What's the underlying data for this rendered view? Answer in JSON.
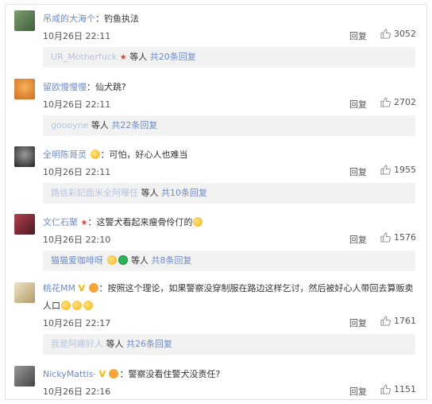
{
  "comments": [
    {
      "username": "吊咸的大海个",
      "text": "钓鱼执法",
      "date": "10月26日 22:11",
      "reply_label": "回复",
      "likes": "3052",
      "sub": {
        "names": "UR_Motherfuck",
        "suffix": "等人",
        "more": "共20条回复"
      },
      "avatar_color": "#5a7a56"
    },
    {
      "username": "留欧慢慢慢",
      "text": "仙犬跳?",
      "date": "10月26日 22:11",
      "reply_label": "回复",
      "likes": "2702",
      "sub": {
        "names": "goooyne",
        "suffix": "等人",
        "more": "共22条回复"
      },
      "avatar_color": "#e07c2a"
    },
    {
      "username": "全明陈哥灵",
      "text": "可怕，好心人也难当",
      "date": "10月26日 22:11",
      "reply_label": "回复",
      "likes": "1955",
      "sub": {
        "names": "路信彩妃面米全阿曝任",
        "suffix": "等人",
        "more": "共10条回复"
      },
      "avatar_color": "#3d3d3d"
    },
    {
      "username": "文仁石聚",
      "text": "这警犬看起来瘦骨伶仃的",
      "date": "10月26日 22:10",
      "reply_label": "回复",
      "likes": "1576",
      "sub": {
        "names": "猫猫爱咖啡呀",
        "suffix": "等人",
        "more": "共8条回复"
      },
      "avatar_color": "#8a2d3a"
    },
    {
      "username": "桃花MM",
      "text": "按照这个理论，如果警察没穿制服在路边这样乞讨，然后被好心人带回去算贩卖人口",
      "date": "10月26日 22:17",
      "reply_label": "回复",
      "likes": "1761",
      "sub": {
        "names": "我是阿娜好人",
        "suffix": "等人",
        "more": "共26条回复"
      },
      "avatar_color": "#c9b68a"
    },
    {
      "username": "NickyMattis·",
      "text": "警察没看住警犬没责任?",
      "date": "10月26日 22:16",
      "reply_label": "回复",
      "likes": "1151",
      "avatar_color": "#6b6b6b"
    }
  ]
}
